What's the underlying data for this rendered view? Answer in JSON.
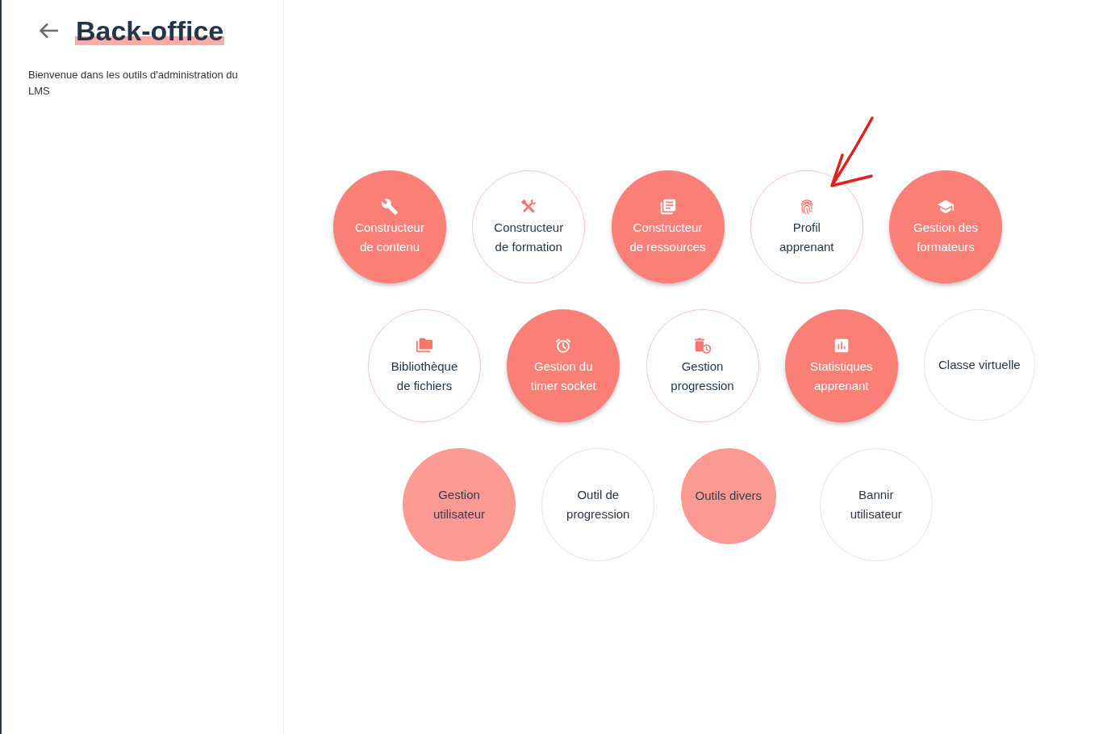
{
  "sidebar": {
    "title": "Back-office",
    "subtitle": "Bienvenue dans les outils d'administration du LMS"
  },
  "tool_grid": {
    "rows": [
      {
        "items": [
          {
            "label": "Constructeur de contenu",
            "kind": "classic",
            "filled": true
          },
          {
            "label": "Constructeur de formation",
            "kind": "classic",
            "filled": false
          },
          {
            "label": "Constructeur de ressources",
            "kind": "classic",
            "filled": true
          },
          {
            "label": "Profil apprenant",
            "kind": "classic",
            "filled": false
          },
          {
            "label": "Gestion des formateurs",
            "kind": "classic",
            "filled": true
          }
        ]
      },
      {
        "items": [
          {
            "label": "Bibliothèque de fichiers",
            "kind": "classic",
            "filled": false
          },
          {
            "label": "Gestion du timer socket",
            "kind": "classic",
            "filled": true
          },
          {
            "label": "Gestion progression",
            "kind": "classic",
            "filled": false
          },
          {
            "label": "Statistiques apprenant",
            "kind": "classic",
            "filled": true
          },
          {
            "label": "Classe virtuelle",
            "kind": "plain",
            "filled": false
          }
        ]
      },
      {
        "items": [
          {
            "label": "Gestion utilisateur",
            "kind": "plain",
            "filled": true
          },
          {
            "label": "Outil de progression",
            "kind": "plain",
            "filled": false
          },
          {
            "label": "Outils divers",
            "kind": "plain",
            "filled": true
          },
          {
            "label": "Bannir utilisateur",
            "kind": "plain",
            "filled": false
          }
        ]
      }
    ]
  }
}
